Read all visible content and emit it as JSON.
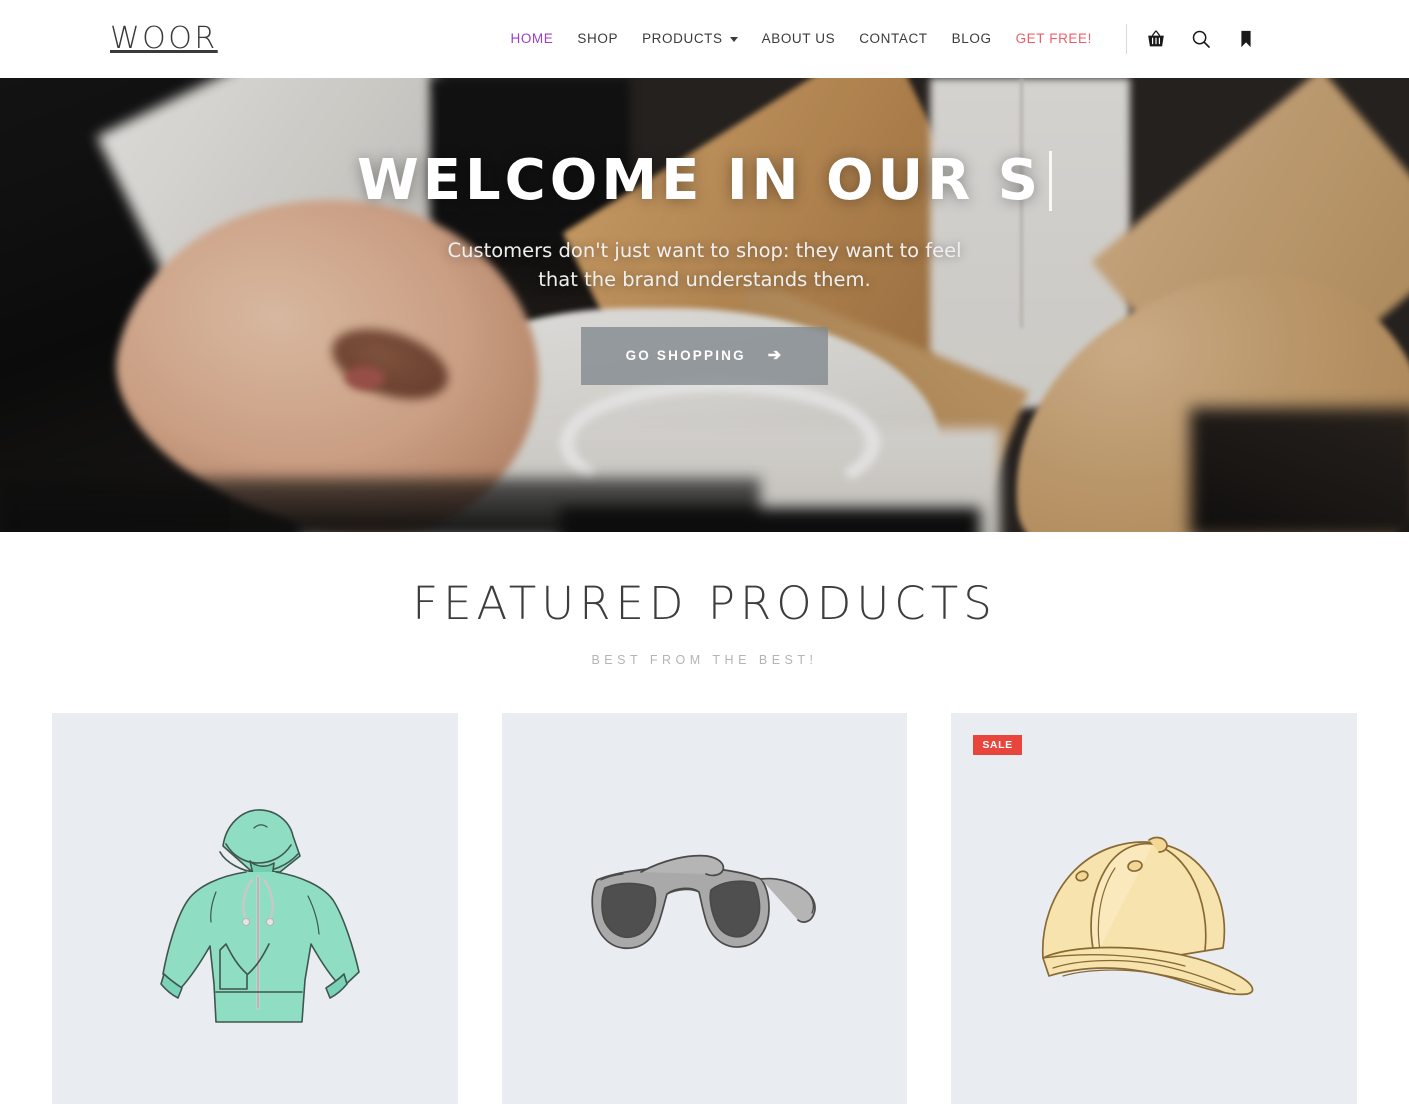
{
  "header": {
    "brand": "WOOR",
    "nav": [
      {
        "label": "HOME",
        "state": "active"
      },
      {
        "label": "SHOP",
        "state": "normal"
      },
      {
        "label": "PRODUCTS",
        "state": "dropdown"
      },
      {
        "label": "ABOUT US",
        "state": "normal"
      },
      {
        "label": "CONTACT",
        "state": "normal"
      },
      {
        "label": "BLOG",
        "state": "normal"
      },
      {
        "label": "GET FREE!",
        "state": "accent"
      }
    ],
    "icons": [
      {
        "name": "basket-icon"
      },
      {
        "name": "search-icon"
      },
      {
        "name": "bookmark-icon"
      }
    ],
    "colors": {
      "active": "#9b3fc6",
      "accent": "#ec5f6a",
      "text": "#3b3b3b"
    }
  },
  "hero": {
    "title": "WELCOME IN OUR S",
    "subtitle_line1": "Customers don't just want to shop: they want to feel",
    "subtitle_line2": "that the brand understands them.",
    "button_label": "GO SHOPPING",
    "button_arrow": "➔",
    "background_description": "hand touching white shirts on wooden hangers"
  },
  "featured": {
    "title": "FEATURED PRODUCTS",
    "subtitle": "BEST FROM THE BEST!",
    "products": [
      {
        "image_name": "hoodie-illustration",
        "badge": null,
        "color": "#8fdec4"
      },
      {
        "image_name": "sunglasses-illustration",
        "badge": null,
        "color": "#9a9a9a"
      },
      {
        "image_name": "cap-illustration",
        "badge": "SALE",
        "color": "#f4dfa4"
      }
    ],
    "card_background": "#e9ecf1",
    "badge_color": "#e8463c"
  }
}
